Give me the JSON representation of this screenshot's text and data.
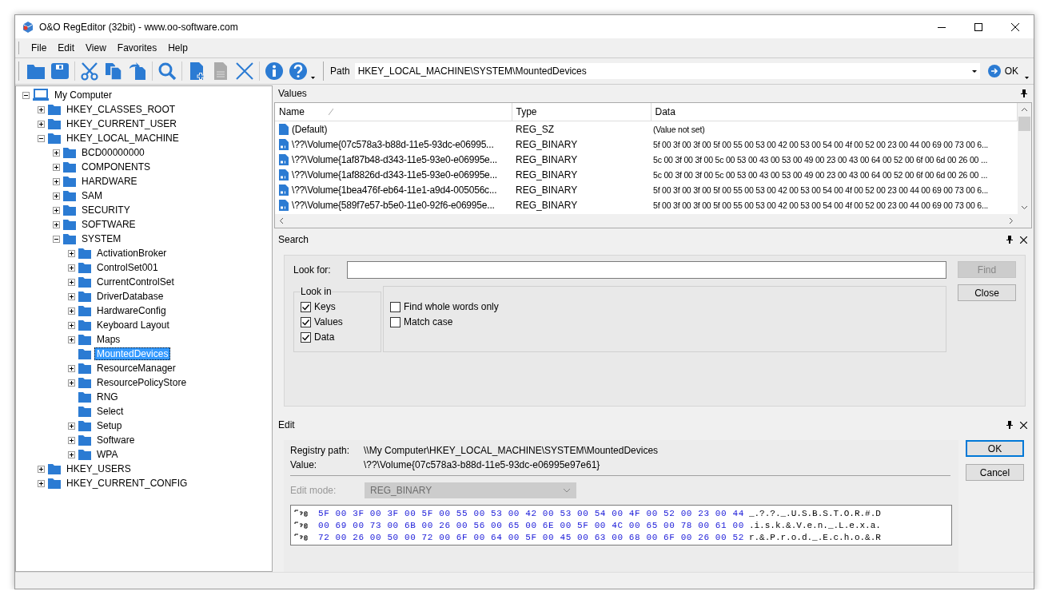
{
  "window": {
    "title": "O&O RegEditor (32bit) - www.oo-software.com"
  },
  "menu": [
    "File",
    "Edit",
    "View",
    "Favorites",
    "Help"
  ],
  "toolbar": {
    "path_label": "Path",
    "path": "HKEY_LOCAL_MACHINE\\SYSTEM\\MountedDevices",
    "go_label": "OK"
  },
  "tree": {
    "label": "My Computer",
    "kind": "expanded",
    "selected": false,
    "children": [
      {
        "label": "HKEY_CLASSES_ROOT",
        "kind": "collapsed",
        "selected": false
      },
      {
        "label": "HKEY_CURRENT_USER",
        "kind": "collapsed",
        "selected": false
      },
      {
        "label": "HKEY_LOCAL_MACHINE",
        "kind": "expanded",
        "selected": false,
        "children": [
          {
            "label": "BCD00000000",
            "kind": "collapsed",
            "selected": false
          },
          {
            "label": "COMPONENTS",
            "kind": "collapsed",
            "selected": false
          },
          {
            "label": "HARDWARE",
            "kind": "collapsed",
            "selected": false
          },
          {
            "label": "SAM",
            "kind": "collapsed",
            "selected": false
          },
          {
            "label": "SECURITY",
            "kind": "collapsed",
            "selected": false
          },
          {
            "label": "SOFTWARE",
            "kind": "collapsed",
            "selected": false
          },
          {
            "label": "SYSTEM",
            "kind": "expanded",
            "selected": false,
            "children": [
              {
                "label": "ActivationBroker",
                "kind": "collapsed",
                "selected": false
              },
              {
                "label": "ControlSet001",
                "kind": "collapsed",
                "selected": false
              },
              {
                "label": "CurrentControlSet",
                "kind": "collapsed",
                "selected": false
              },
              {
                "label": "DriverDatabase",
                "kind": "collapsed",
                "selected": false
              },
              {
                "label": "HardwareConfig",
                "kind": "collapsed",
                "selected": false
              },
              {
                "label": "Keyboard Layout",
                "kind": "collapsed",
                "selected": false
              },
              {
                "label": "Maps",
                "kind": "collapsed",
                "selected": false
              },
              {
                "label": "MountedDevices",
                "kind": "leaf",
                "selected": true
              },
              {
                "label": "ResourceManager",
                "kind": "collapsed",
                "selected": false
              },
              {
                "label": "ResourcePolicyStore",
                "kind": "collapsed",
                "selected": false
              },
              {
                "label": "RNG",
                "kind": "leaf",
                "selected": false
              },
              {
                "label": "Select",
                "kind": "leaf",
                "selected": false
              },
              {
                "label": "Setup",
                "kind": "collapsed",
                "selected": false
              },
              {
                "label": "Software",
                "kind": "collapsed",
                "selected": false
              },
              {
                "label": "WPA",
                "kind": "collapsed",
                "selected": false
              }
            ]
          }
        ]
      },
      {
        "label": "HKEY_USERS",
        "kind": "collapsed",
        "selected": false
      },
      {
        "label": "HKEY_CURRENT_CONFIG",
        "kind": "collapsed",
        "selected": false
      }
    ]
  },
  "values_panel": {
    "title": "Values",
    "columns": [
      "Name",
      "Type",
      "Data"
    ],
    "rows": [
      {
        "kind": "string",
        "name": "(Default)",
        "type": "REG_SZ",
        "data": "(Value not set)"
      },
      {
        "kind": "binary",
        "name": "\\??\\Volume{07c578a3-b88d-11e5-93dc-e06995...",
        "type": "REG_BINARY",
        "data": "5f 00 3f 00 3f 00 5f 00 55 00 53 00 42 00 53 00 54 00 4f 00 52 00 23 00 44 00 69 00 73 00 6..."
      },
      {
        "kind": "binary",
        "name": "\\??\\Volume{1af87b48-d343-11e5-93e0-e06995e...",
        "type": "REG_BINARY",
        "data": "5c 00 3f 00 3f 00 5c 00 53 00 43 00 53 00 49 00 23 00 43 00 64 00 52 00 6f 00 6d 00 26 00 ..."
      },
      {
        "kind": "binary",
        "name": "\\??\\Volume{1af8826d-d343-11e5-93e0-e06995e...",
        "type": "REG_BINARY",
        "data": "5c 00 3f 00 3f 00 5c 00 53 00 43 00 53 00 49 00 23 00 43 00 64 00 52 00 6f 00 6d 00 26 00 ..."
      },
      {
        "kind": "binary",
        "name": "\\??\\Volume{1bea476f-eb64-11e1-a9d4-005056c...",
        "type": "REG_BINARY",
        "data": "5f 00 3f 00 3f 00 5f 00 55 00 53 00 42 00 53 00 54 00 4f 00 52 00 23 00 44 00 69 00 73 00 6..."
      },
      {
        "kind": "binary",
        "name": "\\??\\Volume{589f7e57-b5e0-11e0-92f6-e06995e...",
        "type": "REG_BINARY",
        "data": "5f 00 3f 00 3f 00 5f 00 55 00 53 00 42 00 53 00 54 00 4f 00 52 00 23 00 44 00 69 00 73 00 6..."
      }
    ]
  },
  "search_panel": {
    "title": "Search",
    "look_for_label": "Look for:",
    "find_button": {
      "label": "Find",
      "disabled": true
    },
    "close_button": {
      "label": "Close",
      "disabled": false
    },
    "look_in": {
      "title": "Look in",
      "options": [
        {
          "label": "Keys",
          "checked": true
        },
        {
          "label": "Values",
          "checked": true
        },
        {
          "label": "Data",
          "checked": true
        }
      ]
    },
    "options": [
      {
        "label": "Find whole words only",
        "checked": false
      },
      {
        "label": "Match case",
        "checked": false
      }
    ]
  },
  "edit_panel": {
    "title": "Edit",
    "registry_path_label": "Registry path:",
    "registry_path": "\\\\My Computer\\HKEY_LOCAL_MACHINE\\SYSTEM\\MountedDevices",
    "value_label": "Value:",
    "value": "\\??\\Volume{07c578a3-b88d-11e5-93dc-e06995e97e61}",
    "edit_mode_label": "Edit mode:",
    "edit_mode": "REG_BINARY",
    "edit_mode_disabled": true,
    "hex_rows": [
      {
        "hex": "5F 00 3F 00 3F 00 5F 00 55 00 53 00 42 00 53 00 54 00 4F 00 52 00 23 00 44",
        "ascii": "_.?.?._.U.S.B.S.T.O.R.#.D"
      },
      {
        "hex": "00 69 00 73 00 6B 00 26 00 56 00 65 00 6E 00 5F 00 4C 00 65 00 78 00 61 00",
        "ascii": ".i.s.k.&.V.e.n._.L.e.x.a."
      },
      {
        "hex": "72 00 26 00 50 00 72 00 6F 00 64 00 5F 00 45 00 63 00 68 00 6F 00 26 00 52",
        "ascii": "r.&.P.r.o.d._.E.c.h.o.&.R"
      }
    ],
    "ok_label": "OK",
    "cancel_label": "Cancel"
  }
}
